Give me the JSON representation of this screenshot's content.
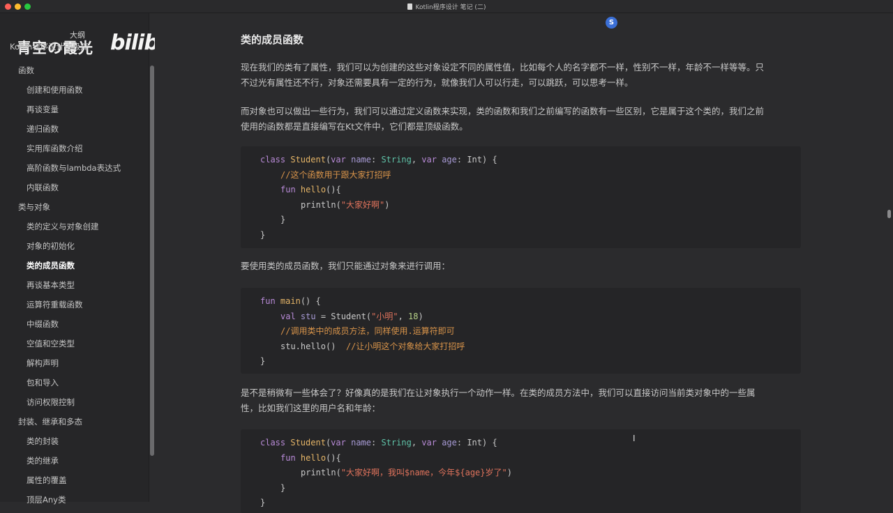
{
  "window": {
    "title": "Kotlin程序设计 笔记 (二)"
  },
  "watermark": {
    "channel": "青空の霞光",
    "outline_label": "大纲",
    "site": "bilibili"
  },
  "sidebar": {
    "outline_title": "Kotlin程序设计中级篇",
    "items": [
      {
        "label": "函数",
        "level": 1,
        "active": false
      },
      {
        "label": "创建和使用函数",
        "level": 2,
        "active": false
      },
      {
        "label": "再谈变量",
        "level": 2,
        "active": false
      },
      {
        "label": "递归函数",
        "level": 2,
        "active": false
      },
      {
        "label": "实用库函数介绍",
        "level": 2,
        "active": false
      },
      {
        "label": "高阶函数与lambda表达式",
        "level": 2,
        "active": false
      },
      {
        "label": "内联函数",
        "level": 2,
        "active": false
      },
      {
        "label": "类与对象",
        "level": 1,
        "active": false
      },
      {
        "label": "类的定义与对象创建",
        "level": 2,
        "active": false
      },
      {
        "label": "对象的初始化",
        "level": 2,
        "active": false
      },
      {
        "label": "类的成员函数",
        "level": 2,
        "active": true
      },
      {
        "label": "再谈基本类型",
        "level": 2,
        "active": false
      },
      {
        "label": "运算符重载函数",
        "level": 2,
        "active": false
      },
      {
        "label": "中缀函数",
        "level": 2,
        "active": false
      },
      {
        "label": "空值和空类型",
        "level": 2,
        "active": false
      },
      {
        "label": "解构声明",
        "level": 2,
        "active": false
      },
      {
        "label": "包和导入",
        "level": 2,
        "active": false
      },
      {
        "label": "访问权限控制",
        "level": 2,
        "active": false
      },
      {
        "label": "封装、继承和多态",
        "level": 1,
        "active": false
      },
      {
        "label": "类的封装",
        "level": 2,
        "active": false
      },
      {
        "label": "类的继承",
        "level": 2,
        "active": false
      },
      {
        "label": "属性的覆盖",
        "level": 2,
        "active": false
      },
      {
        "label": "顶层Any类",
        "level": 2,
        "active": false
      }
    ]
  },
  "main": {
    "heading": "类的成员函数",
    "para1_line1": "现在我们的类有了属性，我们可以为创建的这些对象设定不同的属性值，比如每个人的名字都不一样，性别不一样，年龄不一样等等。只",
    "para1_line2": "不过光有属性还不行，对象还需要具有一定的行为，就像我们人可以行走，可以跳跃，可以思考一样。",
    "para2_line1": "而对象也可以做出一些行为，我们可以通过定义函数来实现，类的函数和我们之前编写的函数有一些区别，它是属于这个类的，我们之前",
    "para2_line2": "使用的函数都是直接编写在Kt文件中，它们都是顶级函数。",
    "para3": "要使用类的成员函数，我们只能通过对象来进行调用：",
    "para4_line1": "是不是稍微有一些体会了？好像真的是我们在让对象执行一个动作一样。在类的成员方法中，我们可以直接访问当前类对象中的一些属",
    "para4_line2": "性，比如我们这里的用户名和年龄：",
    "code1": {
      "kw_class": "class",
      "class_name": "Student",
      "kw_var": "var",
      "p_name": "name",
      "t_string": "String",
      "p_age": "age",
      "t_int": "Int",
      "comment": "//这个函数用于跟大家打招呼",
      "kw_fun": "fun",
      "fn_hello": "hello",
      "fn_println": "println",
      "str": "\"大家好啊\""
    },
    "code2": {
      "kw_fun": "fun",
      "fn_main": "main",
      "kw_val": "val",
      "v_stu": "stu",
      "ctor": "Student",
      "str": "\"小明\"",
      "num": "18",
      "comment1": "//调用类中的成员方法，同样使用.运算符即可",
      "call": "stu.hello()",
      "comment2": "//让小明这个对象给大家打招呼"
    },
    "code3": {
      "kw_class": "class",
      "class_name": "Student",
      "kw_var": "var",
      "p_name": "name",
      "t_string": "String",
      "p_age": "age",
      "t_int": "Int",
      "kw_fun": "fun",
      "fn_hello": "hello",
      "fn_println": "println",
      "str": "\"大家好啊，我叫$name，今年${age}岁了\""
    }
  },
  "icons": {
    "sync": "sync-icon",
    "cursor": "text-cursor-icon",
    "sync_glyph": "S",
    "cursor_glyph": "I"
  }
}
